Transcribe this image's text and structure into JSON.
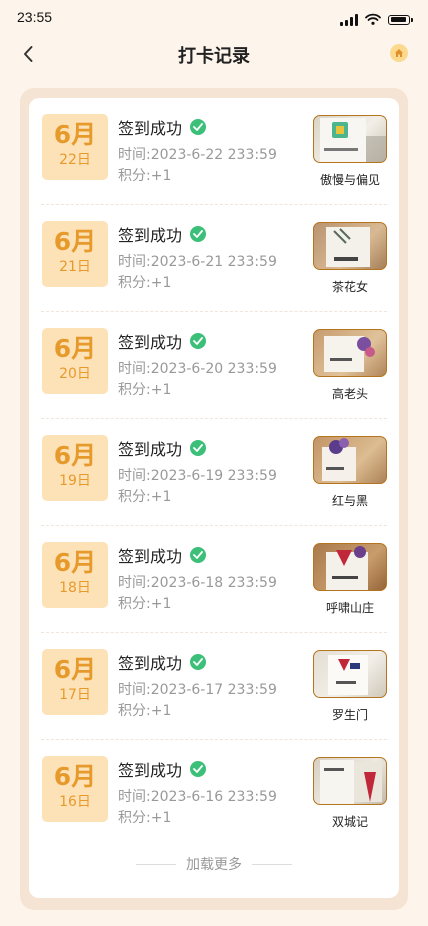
{
  "status": {
    "time": "23:55"
  },
  "header": {
    "title": "打卡记录"
  },
  "colors": {
    "accent": "#e79a2c",
    "badge_bg": "#fde2b7",
    "check_green": "#3cbf78",
    "panel_bg": "#f5e4d3"
  },
  "labels": {
    "time_prefix": "时间:",
    "points_prefix": "积分:"
  },
  "records": [
    {
      "month": "6月",
      "day": "22日",
      "status": "签到成功",
      "time": "2023-6-22 233:59",
      "points": "+1",
      "book": "傲慢与偏见"
    },
    {
      "month": "6月",
      "day": "21日",
      "status": "签到成功",
      "time": "2023-6-21 233:59",
      "points": "+1",
      "book": "茶花女"
    },
    {
      "month": "6月",
      "day": "20日",
      "status": "签到成功",
      "time": "2023-6-20 233:59",
      "points": "+1",
      "book": "高老头"
    },
    {
      "month": "6月",
      "day": "19日",
      "status": "签到成功",
      "time": "2023-6-19 233:59",
      "points": "+1",
      "book": "红与黑"
    },
    {
      "month": "6月",
      "day": "18日",
      "status": "签到成功",
      "time": "2023-6-18 233:59",
      "points": "+1",
      "book": "呼啸山庄"
    },
    {
      "month": "6月",
      "day": "17日",
      "status": "签到成功",
      "time": "2023-6-17 233:59",
      "points": "+1",
      "book": "罗生门"
    },
    {
      "month": "6月",
      "day": "16日",
      "status": "签到成功",
      "time": "2023-6-16 233:59",
      "points": "+1",
      "book": "双城记"
    }
  ],
  "load_more": "加载更多"
}
